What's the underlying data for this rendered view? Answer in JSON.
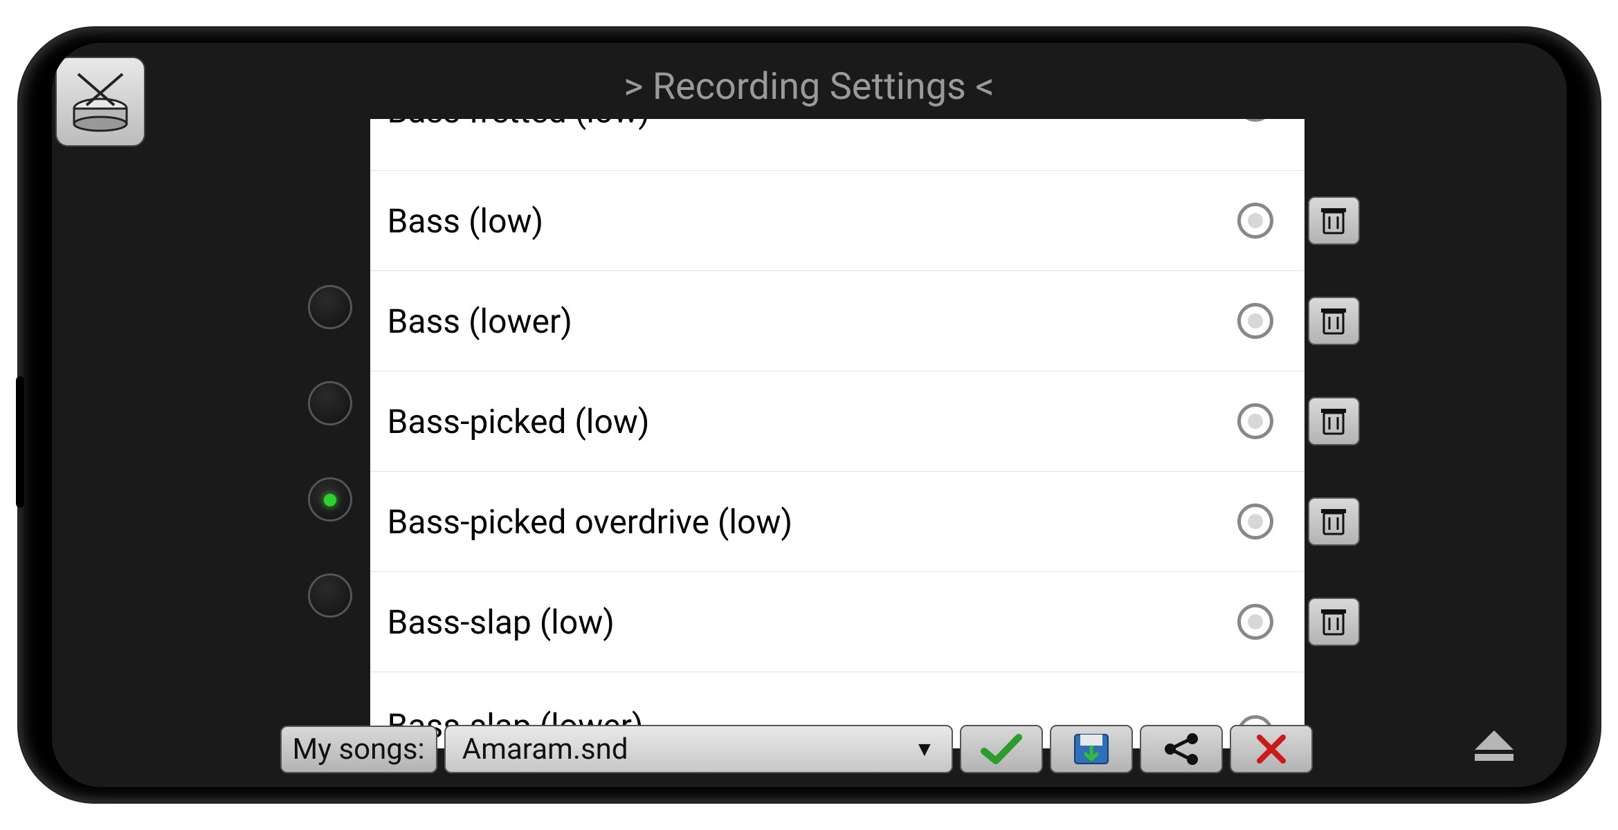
{
  "header": {
    "title": "> Recording Settings <"
  },
  "instrument_options": [
    {
      "label": "Bass fretted (low)",
      "selected": false
    },
    {
      "label": "Bass (low)",
      "selected": false
    },
    {
      "label": "Bass (lower)",
      "selected": false
    },
    {
      "label": "Bass-picked (low)",
      "selected": false
    },
    {
      "label": "Bass-picked overdrive (low)",
      "selected": false
    },
    {
      "label": "Bass-slap (low)",
      "selected": false
    },
    {
      "label": "Bass-slap (lower)",
      "selected": false
    }
  ],
  "track_leds": [
    {
      "on": false
    },
    {
      "on": false
    },
    {
      "on": true
    },
    {
      "on": false
    }
  ],
  "bottom": {
    "songs_label": "My songs:",
    "selected_song": "Amaram.snd"
  },
  "icons": {
    "drum": "drum-icon",
    "trash": "trash-icon",
    "ok": "ok-icon",
    "save": "save-icon",
    "share": "share-icon",
    "delete": "delete-icon",
    "eject": "eject-icon",
    "chevron_down": "chevron-down-icon"
  }
}
